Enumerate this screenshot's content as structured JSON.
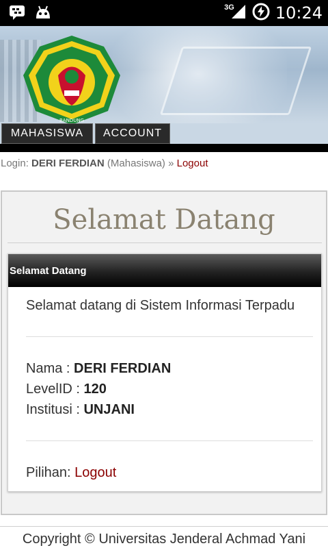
{
  "status_bar": {
    "time": "10:24",
    "network": "3G",
    "icons": [
      "bbm-icon",
      "android-debug-icon",
      "signal-icon",
      "battery-charging-icon"
    ]
  },
  "header": {
    "logo_icon": "university-crest-icon",
    "logo_text": "UNIVERSITAS JENDERAL ACHMAD YANI"
  },
  "nav": {
    "items": [
      {
        "label": "MAHASISWA"
      },
      {
        "label": "ACCOUNT"
      }
    ]
  },
  "login": {
    "prefix": "Login:",
    "user": "DERI FERDIAN",
    "role": "(Mahasiswa)",
    "separator": "»",
    "logout": "Logout"
  },
  "main": {
    "title": "Selamat Datang",
    "card": {
      "header": "Selamat Datang",
      "welcome": "Selamat datang di Sistem Informasi Terpadu",
      "nama_label": "Nama :",
      "nama_value": "DERI FERDIAN",
      "level_label": "LevelID :",
      "level_value": "120",
      "institusi_label": "Institusi :",
      "institusi_value": "UNJANI",
      "pilihan_label": "Pilihan:",
      "pilihan_link": "Logout"
    }
  },
  "footer": {
    "copyright": "Copyright © Universitas Jenderal Achmad Yani"
  },
  "colors": {
    "link": "#8b0000",
    "title": "#8a8270",
    "card_header": "#222222"
  }
}
